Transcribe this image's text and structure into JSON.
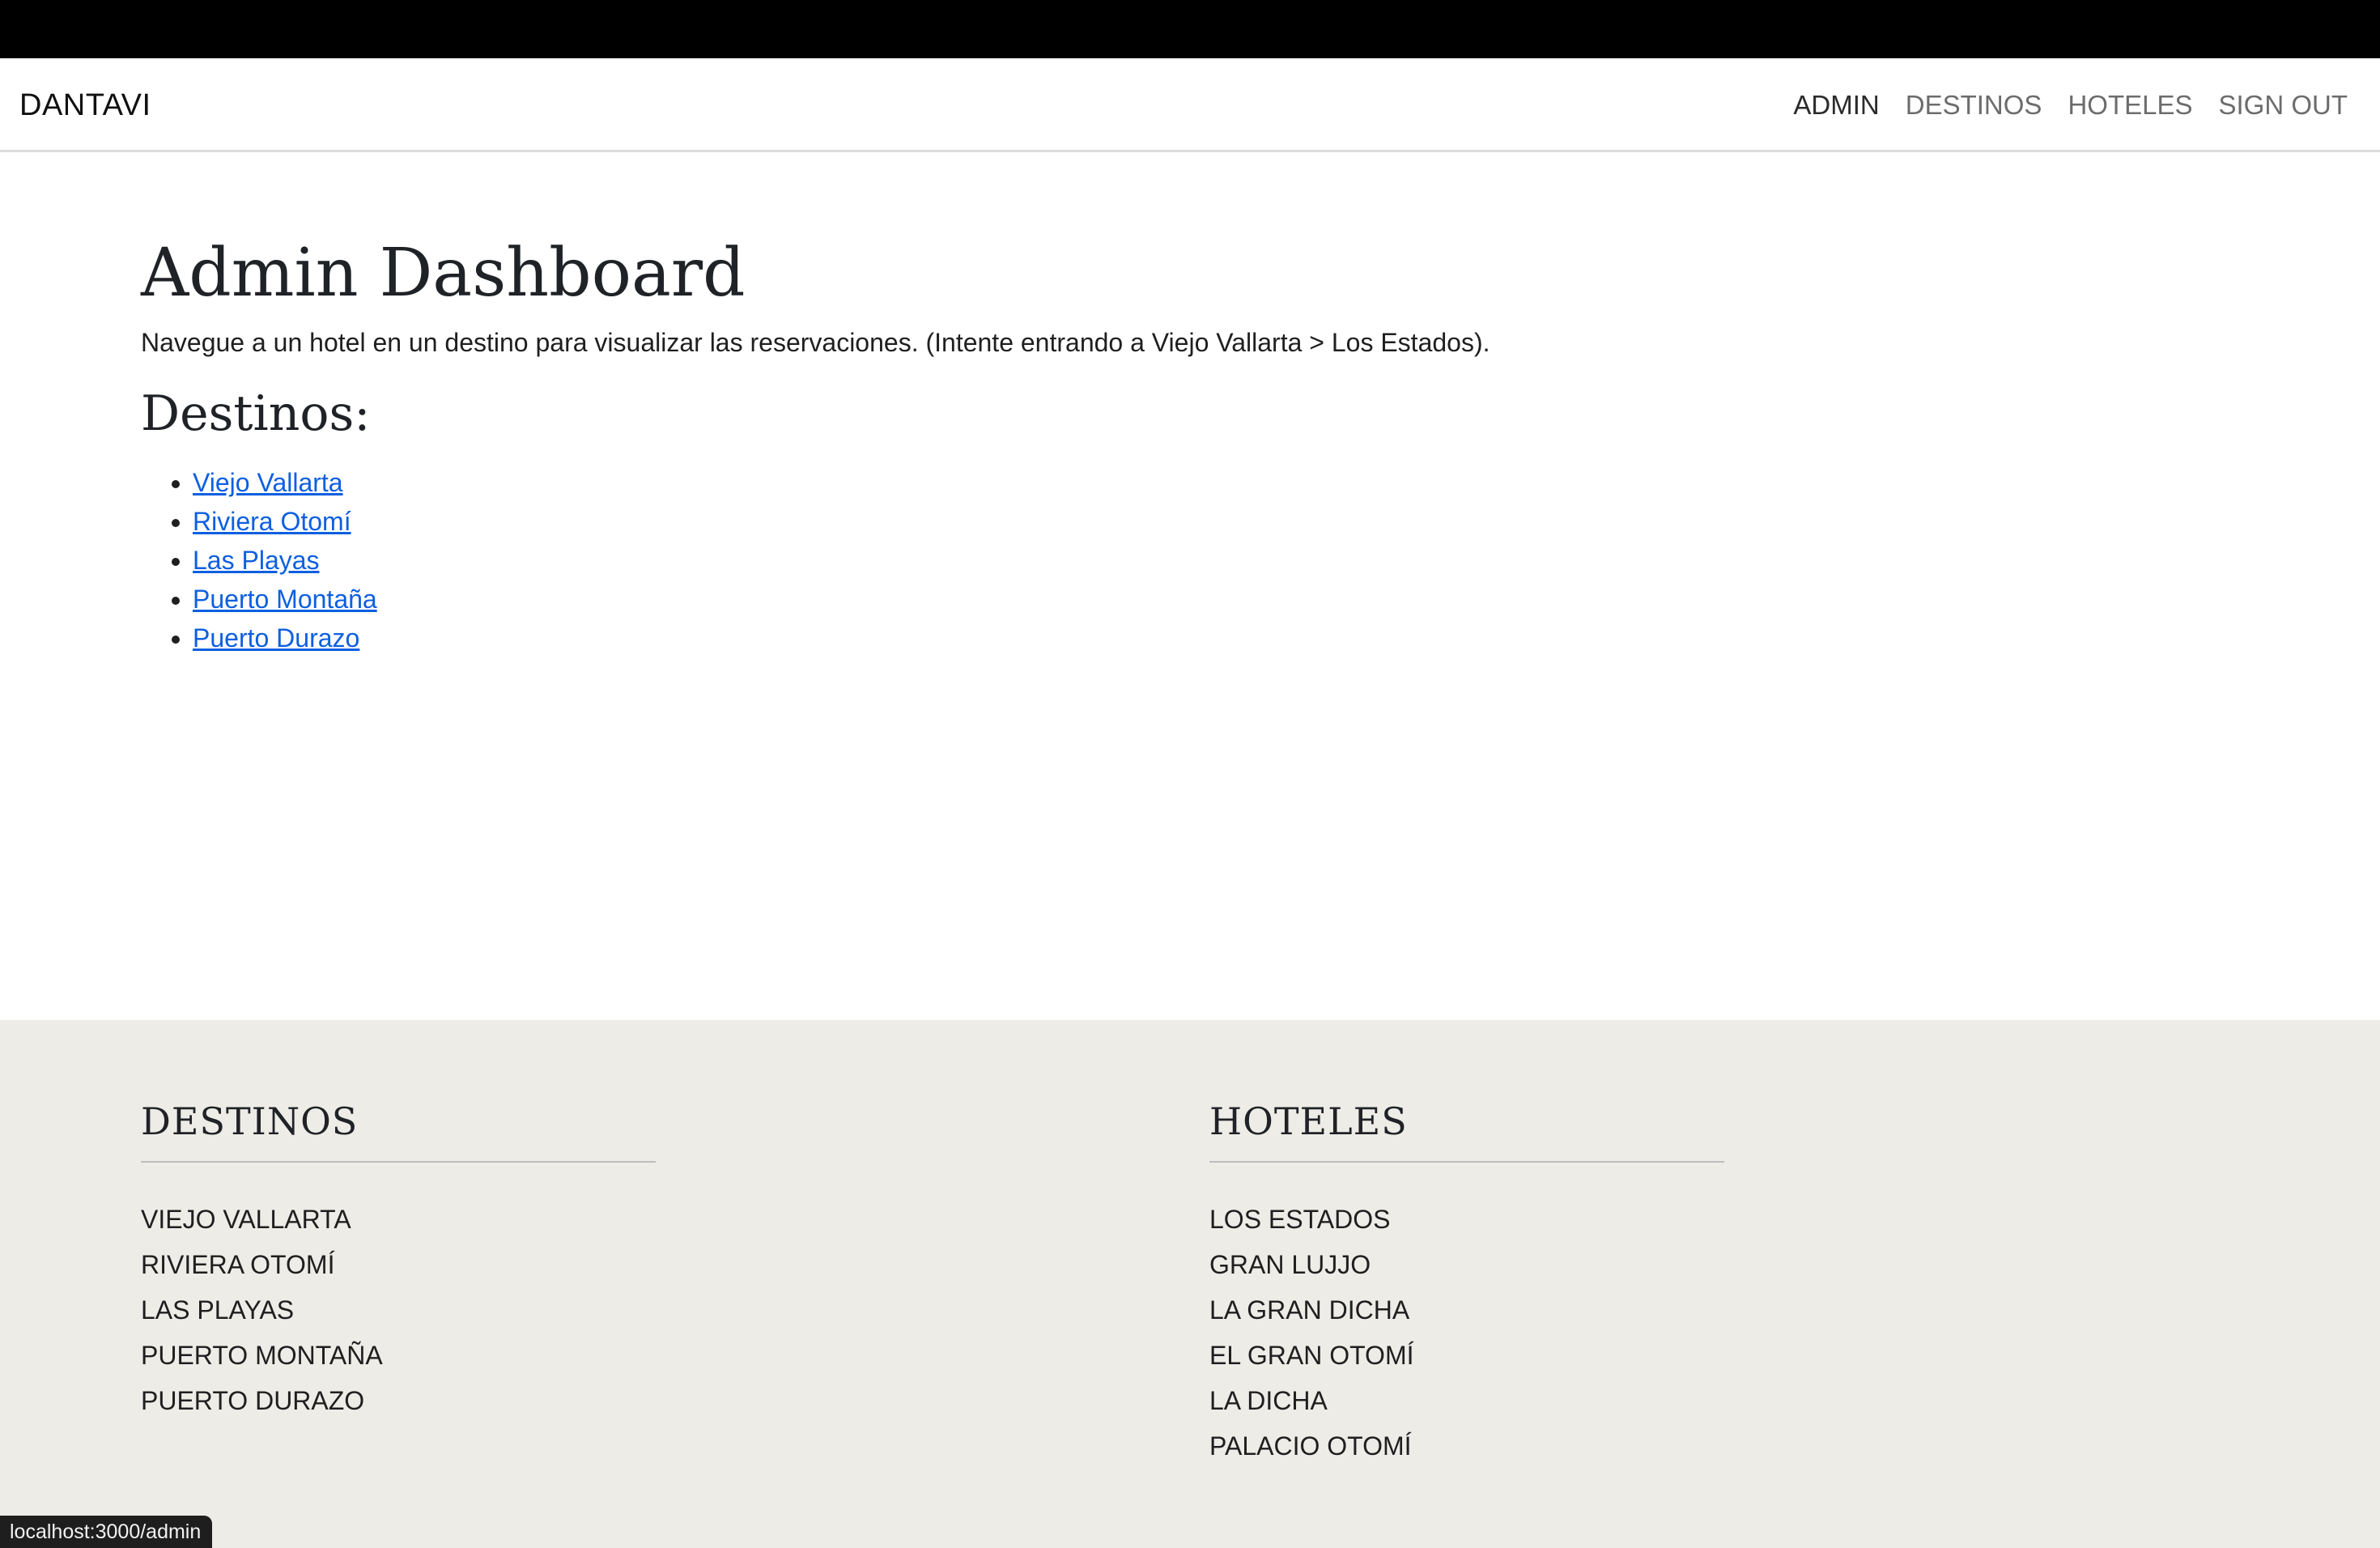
{
  "navbar": {
    "brand": "DANTAVI",
    "links": [
      {
        "label": "ADMIN"
      },
      {
        "label": "DESTINOS"
      },
      {
        "label": "HOTELES"
      },
      {
        "label": "SIGN OUT"
      }
    ]
  },
  "main": {
    "title": "Admin Dashboard",
    "intro": "Navegue a un hotel en un destino para visualizar las reservaciones. (Intente entrando a Viejo Vallarta > Los Estados).",
    "destinos_title": "Destinos:",
    "destinos": [
      "Viejo Vallarta",
      "Riviera Otomí",
      "Las Playas",
      "Puerto Montaña",
      "Puerto Durazo"
    ]
  },
  "footer": {
    "destinos_title": "DESTINOS",
    "destinos": [
      "VIEJO VALLARTA",
      "RIVIERA OTOMÍ",
      "LAS PLAYAS",
      "PUERTO MONTAÑA",
      "PUERTO DURAZO"
    ],
    "hoteles_title": "HOTELES",
    "hoteles": [
      "LOS ESTADOS",
      "GRAN LUJJO",
      "LA GRAN DICHA",
      "EL GRAN OTOMÍ",
      "LA DICHA",
      "PALACIO OTOMÍ"
    ]
  },
  "status_bar": {
    "url": "localhost:3000/admin"
  },
  "colors": {
    "link": "#0d5fe0",
    "footer_bg": "#eeece7",
    "top_bar": "#000000"
  }
}
